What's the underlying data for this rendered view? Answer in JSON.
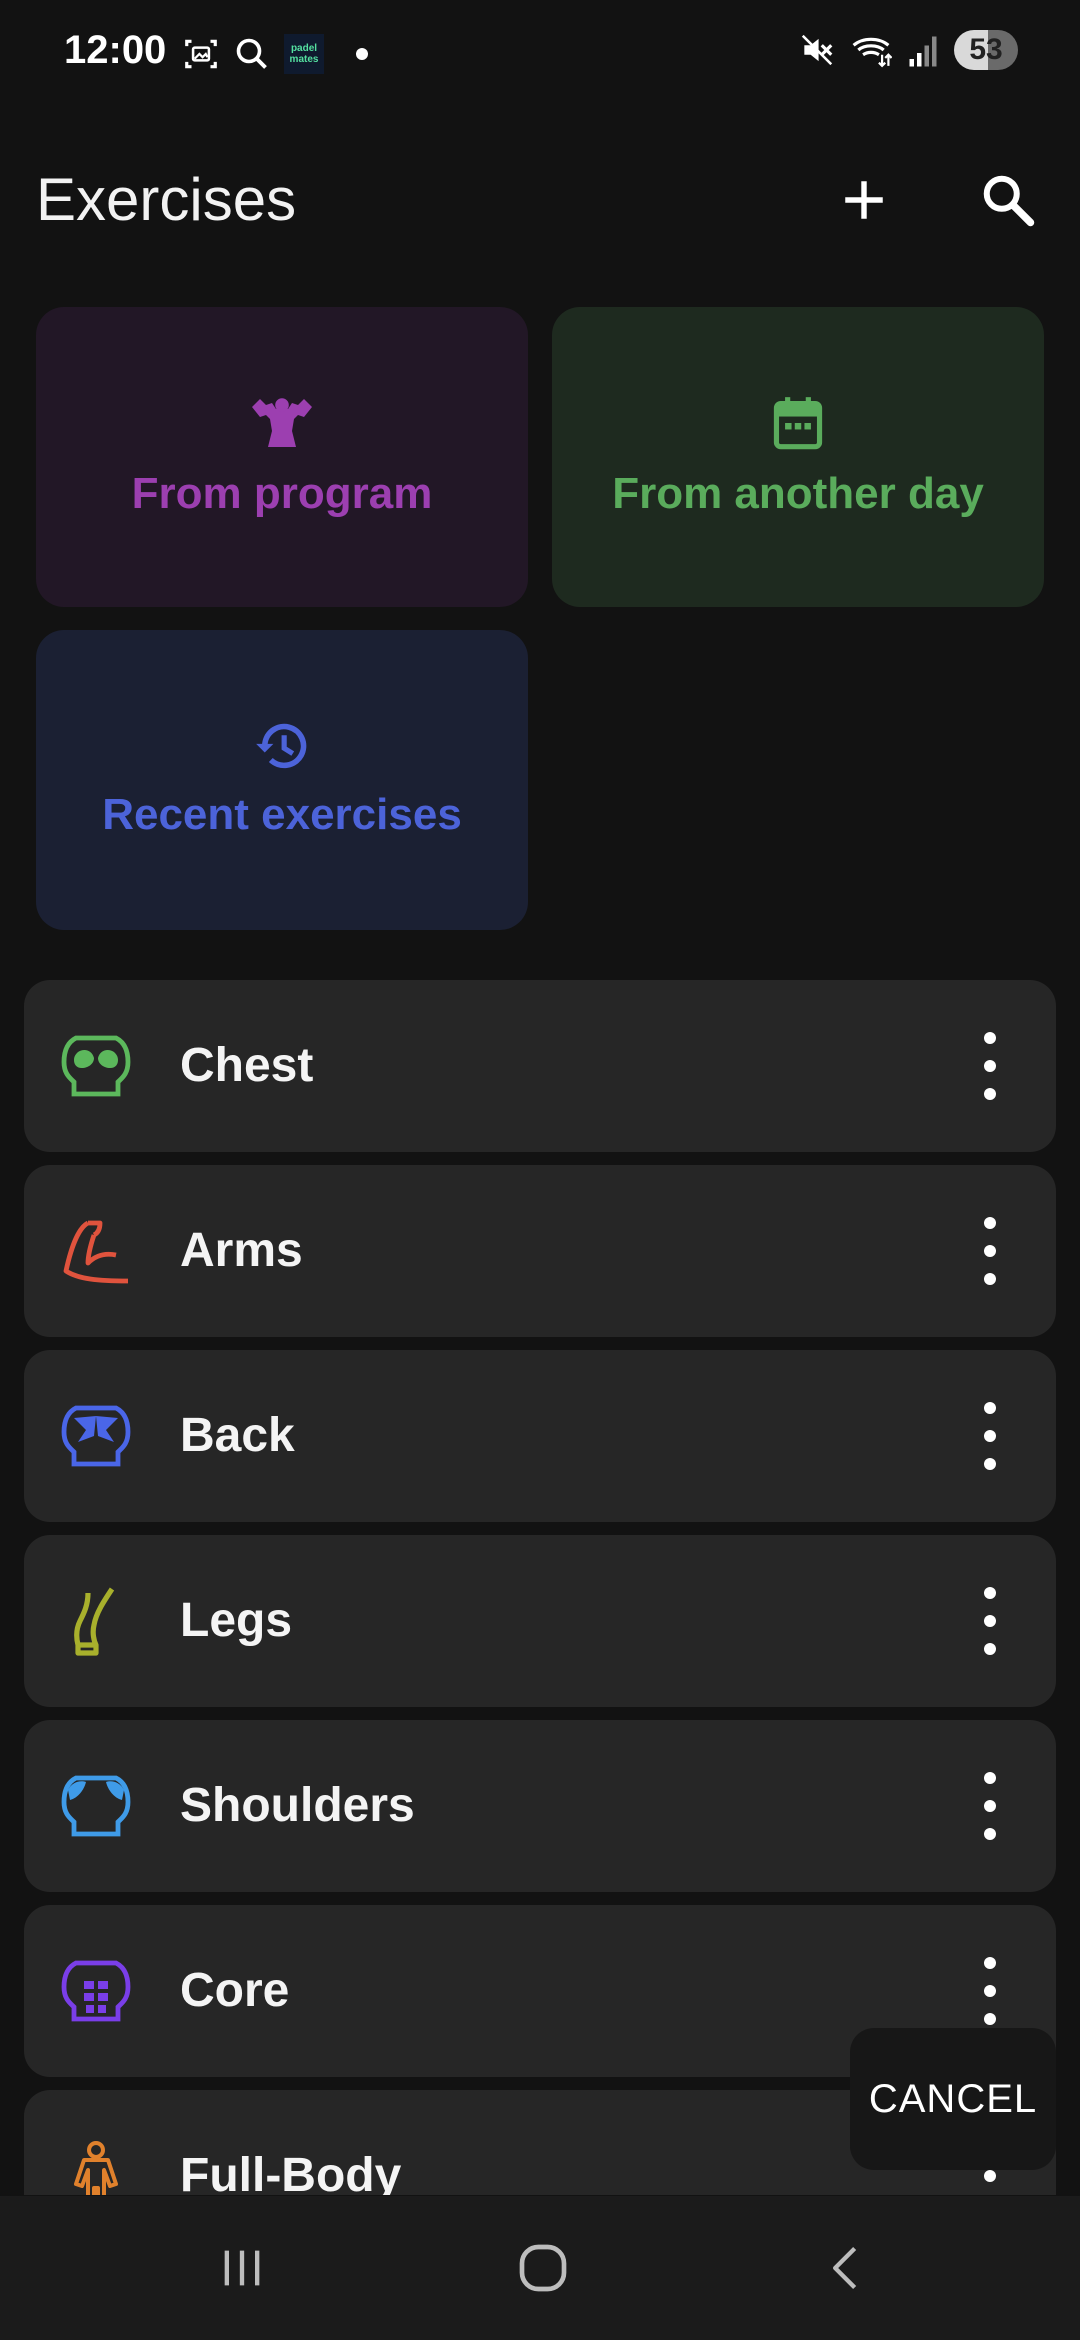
{
  "status_bar": {
    "time": "12:00",
    "app_badge": "padel mates",
    "battery": "53"
  },
  "header": {
    "title": "Exercises"
  },
  "tiles": {
    "from_program": "From program",
    "from_another_day": "From another day",
    "recent_exercises": "Recent exercises"
  },
  "categories": [
    {
      "label": "Chest",
      "icon": "chest-icon",
      "color": "#5cb85c"
    },
    {
      "label": "Arms",
      "icon": "arm-icon",
      "color": "#e0533d"
    },
    {
      "label": "Back",
      "icon": "back-icon",
      "color": "#4a66e8"
    },
    {
      "label": "Legs",
      "icon": "leg-icon",
      "color": "#a8b02c"
    },
    {
      "label": "Shoulders",
      "icon": "shoulders-icon",
      "color": "#3f9be8"
    },
    {
      "label": "Core",
      "icon": "core-icon",
      "color": "#7a3ee8"
    },
    {
      "label": "Full-Body",
      "icon": "full-body-icon",
      "color": "#e0812c"
    }
  ],
  "cancel_label": "CANCEL",
  "colors": {
    "program": "#9c3fb0",
    "another_day": "#5aac5c",
    "recent": "#4c63d9"
  }
}
